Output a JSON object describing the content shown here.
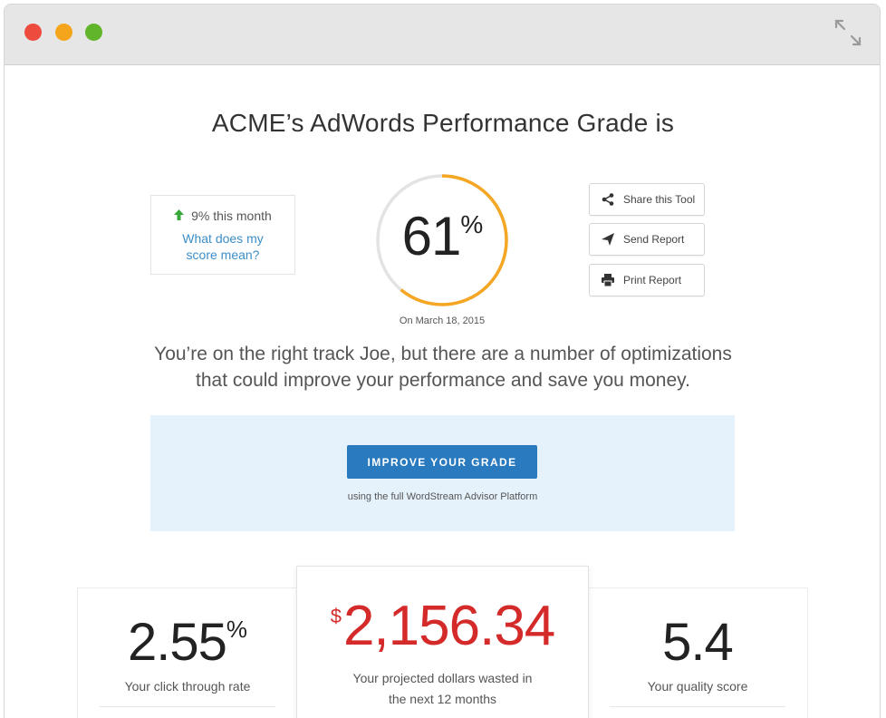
{
  "window": {
    "controls": [
      "close",
      "minimize",
      "zoom"
    ],
    "expand_icon": "expand-icon",
    "colors": {
      "close": "#ee4b3f",
      "minimize": "#f5a51c",
      "zoom": "#61b52a"
    }
  },
  "header": {
    "title": "ACME’s AdWords Performance Grade is"
  },
  "trend": {
    "arrow_icon": "arrow-up-icon",
    "text": "9% this month",
    "link": "What does my score mean?"
  },
  "grade": {
    "value": "61",
    "unit": "%",
    "progress": 0.61,
    "date": "On March 18, 2015",
    "colors": {
      "progress": "#f5a623",
      "track": "#e3e3e3"
    }
  },
  "actions": {
    "share": {
      "label": "Share this Tool",
      "icon": "share-icon"
    },
    "send": {
      "label": "Send Report",
      "icon": "send-icon"
    },
    "print": {
      "label": "Print Report",
      "icon": "print-icon"
    }
  },
  "message": {
    "line1": "You’re on the right track Joe, but there are a number of optimizations",
    "line2": "that could improve your performance and save you money."
  },
  "cta": {
    "button": "IMPROVE YOUR GRADE",
    "subtext": "using the full WordStream Advisor Platform",
    "colors": {
      "button": "#2a7ac0",
      "panel": "#e6f2fb"
    }
  },
  "stats": {
    "ctr": {
      "value": "2.55",
      "unit": "%",
      "label": "Your click through rate"
    },
    "wasted": {
      "currency": "$",
      "value": "2,156.34",
      "label": "Your projected dollars wasted in the next 12 months",
      "color": "#d42a2a"
    },
    "quality": {
      "value": "5.4",
      "label": "Your quality score"
    }
  }
}
